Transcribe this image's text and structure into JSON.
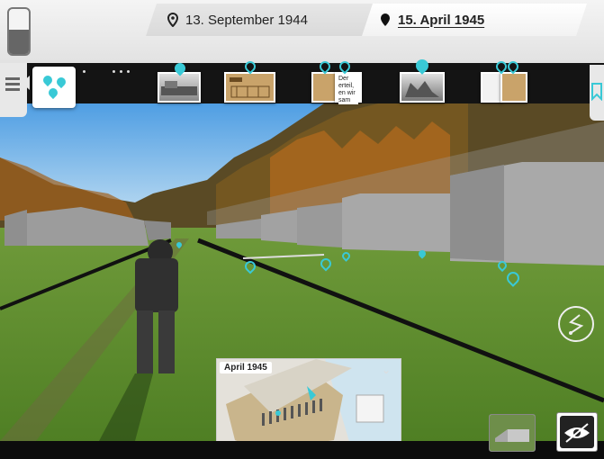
{
  "battery": {
    "level_percent": 55
  },
  "tabs": [
    {
      "label": "13. September 1944",
      "active": false
    },
    {
      "label": "15. April 1945",
      "active": true
    }
  ],
  "timeline": {
    "document_text": "Der erteil, en wir sam",
    "icons": [
      "photo-barracks",
      "document-plan",
      "document-text",
      "photo-ruins",
      "document-map"
    ]
  },
  "minimap": {
    "label": "April 1945"
  },
  "colors": {
    "accent": "#39c9d6",
    "sky": "#6fb0e6",
    "grass": "#5f8f2c"
  },
  "icons": {
    "menu": "menu-icon",
    "back": "chevron-left-icon",
    "location": "location-pin-icon",
    "bookmark": "bookmark-icon",
    "route": "route-icon",
    "barrack": "barrack-icon",
    "eye": "eye-icon",
    "collapse": "chevron-down-icon"
  }
}
